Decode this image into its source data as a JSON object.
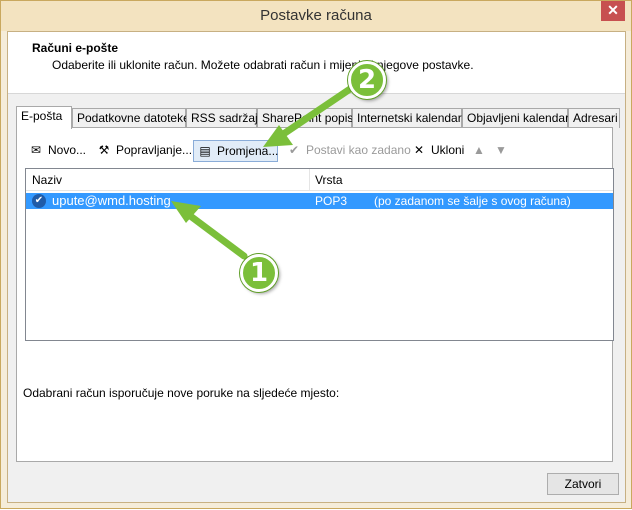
{
  "window": {
    "title": "Postavke računa",
    "close_glyph": "✕"
  },
  "header": {
    "heading": "Računi e-pošte",
    "description": "Odaberite ili uklonite račun. Možete odabrati račun i mijenjati njegove postavke."
  },
  "tabs": [
    {
      "label": "E-pošta",
      "active": true
    },
    {
      "label": "Podatkovne datoteke"
    },
    {
      "label": "RSS sadržaji"
    },
    {
      "label": "SharePoint popisi"
    },
    {
      "label": "Internetski kalendari"
    },
    {
      "label": "Objavljeni kalendari"
    },
    {
      "label": "Adresari"
    }
  ],
  "toolbar": {
    "new_label": "Novo...",
    "repair_label": "Popravljanje...",
    "change_label": "Promjena...",
    "set_default_label": "Postavi kao zadano",
    "remove_label": "Ukloni",
    "icons": {
      "new": "envelope-icon",
      "repair": "tools-icon",
      "change": "change-icon",
      "set_default": "checkmark-icon",
      "remove": "x-icon",
      "up": "arrow-up-icon",
      "down": "arrow-down-icon"
    }
  },
  "accounts_table": {
    "columns": [
      "Naziv",
      "Vrsta"
    ],
    "rows": [
      {
        "name": "upute@wmd.hosting",
        "type": "POP3",
        "note": "(po zadanom se šalje s ovog računa)",
        "selected": true
      }
    ]
  },
  "delivery_text": "Odabrani račun isporučuje nove poruke na sljedeće mjesto:",
  "footer": {
    "close_label": "Zatvori"
  },
  "annotations": [
    {
      "number": "1"
    },
    {
      "number": "2"
    }
  ],
  "colors": {
    "selection": "#3399ff",
    "callout": "#7bbf3a"
  }
}
